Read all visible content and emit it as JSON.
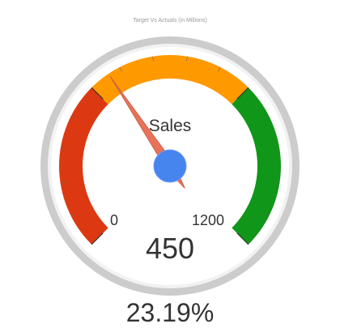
{
  "chart_data": {
    "type": "gauge",
    "title": "Target Vs Actuals (in Millions)",
    "label": "Sales",
    "min": 0,
    "max": 1200,
    "value": 450,
    "value_text": "450",
    "min_text": "0",
    "max_text": "1200",
    "bands": [
      {
        "from": 0,
        "to": 400,
        "color": "#dc3912"
      },
      {
        "from": 400,
        "to": 800,
        "color": "#ff9900"
      },
      {
        "from": 800,
        "to": 1200,
        "color": "#109618"
      }
    ],
    "minor_ticks": 5,
    "needle_color": "#e8735a",
    "hub_color": "#4684ee",
    "rim_color": "#cccccc"
  },
  "footer": {
    "percentage": "23.19%"
  }
}
